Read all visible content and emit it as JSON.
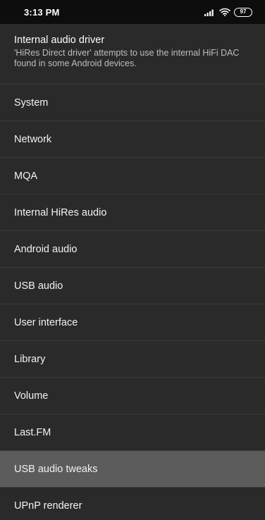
{
  "status_bar": {
    "time": "3:13 PM",
    "battery": "97",
    "icons": [
      "signal-icon",
      "wifi-icon",
      "battery-icon"
    ]
  },
  "header": {
    "title": "Internal audio driver",
    "summary": "'HiRes Direct driver' attempts to use the internal HiFi DAC found in some Android devices."
  },
  "menu": {
    "items": [
      {
        "label": "System"
      },
      {
        "label": "Network"
      },
      {
        "label": "MQA"
      },
      {
        "label": "Internal HiRes audio"
      },
      {
        "label": "Android audio"
      },
      {
        "label": "USB audio"
      },
      {
        "label": "User interface"
      },
      {
        "label": "Library"
      },
      {
        "label": "Volume"
      },
      {
        "label": "Last.FM"
      },
      {
        "label": "USB audio tweaks",
        "highlighted": true
      },
      {
        "label": "UPnP renderer"
      }
    ]
  },
  "colors": {
    "background": "#2a2a2a",
    "status_bar": "#0d0d0d",
    "highlight": "#5c5c5c",
    "divider": "#3a3a3a"
  }
}
